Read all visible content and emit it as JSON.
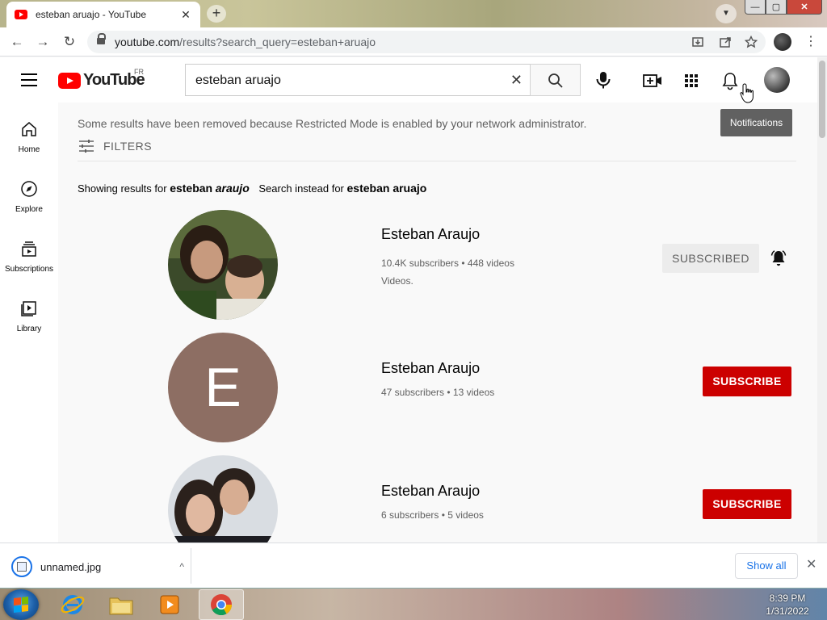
{
  "browser": {
    "tab_title": "esteban aruajo - YouTube",
    "tab_close": "✕",
    "new_tab": "+",
    "url_host": "youtube.com",
    "url_path": "/results?search_query=esteban+aruajo",
    "nav_back": "←",
    "nav_forward": "→",
    "nav_reload": "↻",
    "menu": "⋮",
    "window_min": "—",
    "window_max": "▢",
    "window_close": "✕"
  },
  "youtube": {
    "logo_text": "YouTube",
    "region": "FR",
    "search_query": "esteban aruajo",
    "clear": "✕",
    "tooltip": "Notifications"
  },
  "sidebar": {
    "items": [
      {
        "label": "Home"
      },
      {
        "label": "Explore"
      },
      {
        "label": "Subscriptions"
      },
      {
        "label": "Library"
      }
    ]
  },
  "results": {
    "notice": "Some results have been removed because Restricted Mode is enabled by your network administrator.",
    "filters_label": "FILTERS",
    "showing_prefix": "Showing results for",
    "showing_term_1": "esteban",
    "showing_term_2": "araujo",
    "instead_prefix": "Search instead for",
    "instead_term": "esteban aruajo",
    "channels": [
      {
        "name": "Esteban Araujo",
        "meta": "10.4K subscribers • 448 videos",
        "description": "Videos.",
        "button": "SUBSCRIBED"
      },
      {
        "name": "Esteban Araujo",
        "meta": "47 subscribers • 13 videos",
        "avatar_letter": "E",
        "button": "SUBSCRIBE"
      },
      {
        "name": "Esteban Araujo",
        "meta": "6 subscribers • 5 videos",
        "button": "SUBSCRIBE"
      }
    ]
  },
  "downloads": {
    "file_name": "unnamed.jpg",
    "chevron": "^",
    "show_all": "Show all",
    "close": "✕"
  },
  "taskbar": {
    "time": "8:39 PM",
    "date": "1/31/2022"
  },
  "colors": {
    "youtube_red": "#ff0000",
    "subscribe_red": "#cc0000",
    "chrome_blue": "#1a73e8"
  }
}
